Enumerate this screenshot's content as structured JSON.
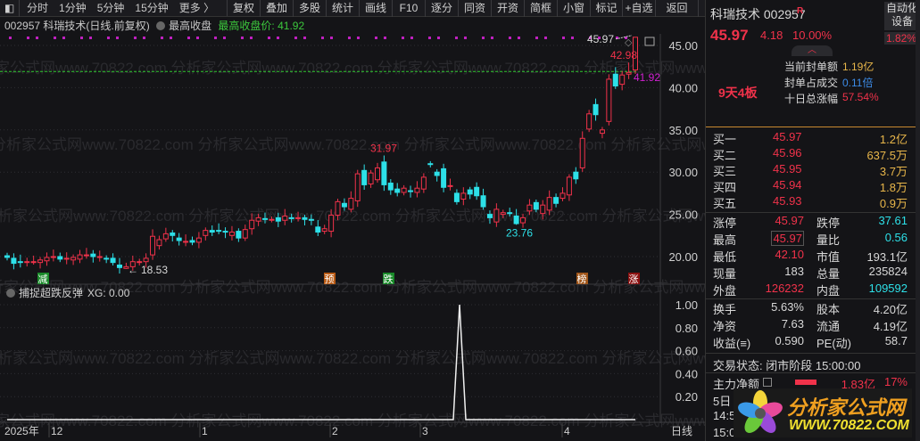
{
  "toolbar": {
    "periods": [
      "分时",
      "1分钟",
      "5分钟",
      "15分钟",
      "更多 〉"
    ],
    "buttons": [
      "复权",
      "叠加",
      "多股",
      "统计",
      "画线",
      "F10",
      "逐分",
      "同资",
      "开资",
      "简框",
      "小窗",
      "标记",
      "+自选",
      "返回"
    ]
  },
  "info": {
    "code_name": "002957 科瑞技术(日线.前复权)",
    "indicator": "最高收盘",
    "value_label": "最高收盘价: 41.92"
  },
  "watermark": "分析家公式网www.70822.com",
  "price_axis": [
    "45.00",
    "40.00",
    "35.00",
    "30.00",
    "25.00",
    "20.00"
  ],
  "annotations": {
    "top": "45.97",
    "prev_high": "42.98",
    "ref": "41.92",
    "peak": "31.97",
    "trough": "23.76",
    "low": "18.53"
  },
  "signals": [
    {
      "label": "减",
      "color": "#1a8a2a"
    },
    {
      "label": "预",
      "color": "#b85a14"
    },
    {
      "label": "跌",
      "color": "#1a8a2a"
    },
    {
      "label": "榜",
      "color": "#a0561a"
    },
    {
      "label": "涨",
      "color": "#8a1010"
    }
  ],
  "indicator_pane": {
    "title": "捕捉超跌反弹",
    "value": "XG: 0.00",
    "axis": [
      "1.00",
      "0.80",
      "0.60",
      "0.40",
      "0.20"
    ]
  },
  "x_axis": {
    "year": "2025年",
    "months": [
      "12",
      "1",
      "2",
      "3",
      "4"
    ],
    "period": "日线"
  },
  "candles": [
    [
      20.1,
      19.9
    ],
    [
      19.8,
      19.2
    ],
    [
      19.4,
      19.3
    ],
    [
      19.3,
      19.4
    ],
    [
      19.4,
      19.4
    ],
    [
      19.3,
      19.6
    ],
    [
      19.5,
      19.9
    ],
    [
      19.9,
      20.0
    ],
    [
      20.0,
      19.7
    ],
    [
      19.8,
      19.8
    ],
    [
      19.6,
      19.9
    ],
    [
      19.7,
      20.2
    ],
    [
      20.1,
      20.2
    ],
    [
      20.3,
      20.0
    ],
    [
      20.0,
      20.0
    ],
    [
      19.8,
      19.7
    ],
    [
      19.8,
      19.3
    ],
    [
      19.0,
      18.7
    ],
    [
      18.6,
      18.8
    ],
    [
      18.8,
      19.4
    ],
    [
      19.3,
      19.4
    ],
    [
      19.4,
      19.8
    ],
    [
      20.2,
      22.4
    ],
    [
      21.3,
      22.0
    ],
    [
      22.1,
      22.7
    ],
    [
      22.8,
      22.5
    ],
    [
      22.2,
      21.9
    ],
    [
      21.7,
      21.8
    ],
    [
      21.9,
      21.7
    ],
    [
      21.7,
      22.2
    ],
    [
      22.5,
      23.1
    ],
    [
      23.1,
      22.9
    ],
    [
      23.1,
      23.0
    ],
    [
      23.0,
      22.9
    ],
    [
      22.5,
      22.9
    ],
    [
      23.0,
      22.2
    ],
    [
      22.2,
      23.2
    ],
    [
      23.3,
      24.3
    ],
    [
      24.2,
      24.6
    ],
    [
      24.5,
      24.4
    ],
    [
      24.4,
      24.4
    ],
    [
      24.6,
      24.2
    ],
    [
      24.3,
      24.8
    ],
    [
      24.6,
      24.5
    ],
    [
      24.5,
      24.6
    ],
    [
      24.6,
      24.4
    ],
    [
      24.4,
      24.3
    ],
    [
      23.5,
      22.9
    ],
    [
      23.0,
      23.3
    ],
    [
      23.0,
      24.9
    ],
    [
      24.9,
      26.5
    ],
    [
      26.3,
      25.9
    ],
    [
      25.6,
      26.9
    ],
    [
      26.6,
      29.8
    ],
    [
      30.2,
      28.5
    ],
    [
      28.6,
      29.9
    ],
    [
      29.1,
      30.5
    ],
    [
      31.2,
      28.5
    ],
    [
      28.7,
      27.9
    ],
    [
      28.0,
      27.6
    ],
    [
      27.6,
      28.1
    ],
    [
      27.8,
      27.7
    ],
    [
      27.6,
      28.1
    ],
    [
      28.0,
      29.4
    ],
    [
      31.0,
      30.9
    ],
    [
      30.0,
      29.6
    ],
    [
      30.4,
      28.2
    ],
    [
      28.3,
      28.4
    ],
    [
      27.5,
      26.5
    ],
    [
      26.8,
      27.5
    ],
    [
      27.9,
      27.4
    ],
    [
      28.2,
      27.2
    ],
    [
      27.2,
      25.9
    ],
    [
      25.0,
      24.6
    ],
    [
      24.1,
      25.6
    ],
    [
      25.0,
      25.2
    ],
    [
      25.2,
      25.1
    ],
    [
      24.8,
      23.9
    ],
    [
      24.0,
      24.6
    ],
    [
      25.4,
      26.1
    ],
    [
      26.4,
      25.6
    ],
    [
      25.1,
      26.1
    ],
    [
      25.5,
      27.0
    ],
    [
      27.0,
      26.3
    ],
    [
      26.9,
      27.5
    ],
    [
      27.3,
      29.4
    ],
    [
      30.0,
      29.2
    ],
    [
      30.5,
      34.0
    ],
    [
      35.1,
      36.9
    ],
    [
      38.0,
      36.8
    ],
    [
      34.6,
      35.0
    ],
    [
      36.0,
      41.0
    ],
    [
      41.6,
      40.2
    ],
    [
      40.4,
      41.5
    ],
    [
      41.6,
      41.8
    ],
    [
      42.1,
      45.97
    ]
  ],
  "panel": {
    "name": "科瑞技术 002957",
    "r_badge": "R",
    "sector": "自动化设备",
    "price": "45.97",
    "change": "4.18",
    "pct": "10.00%",
    "sector_pct": "1.82%",
    "streak": "9天4板",
    "seal": [
      {
        "label": "当前封单额",
        "value": "1.19亿"
      },
      {
        "label": "封单占成交",
        "value": "0.11倍"
      },
      {
        "label": "十日总涨幅",
        "value": "57.54%"
      }
    ],
    "bids": [
      {
        "label": "买一",
        "price": "45.97",
        "vol": "1.2亿"
      },
      {
        "label": "买二",
        "price": "45.96",
        "vol": "637.5万"
      },
      {
        "label": "买三",
        "price": "45.95",
        "vol": "3.7万"
      },
      {
        "label": "买四",
        "price": "45.94",
        "vol": "1.8万"
      },
      {
        "label": "买五",
        "price": "45.93",
        "vol": "0.9万"
      }
    ],
    "stats1": [
      [
        "涨停",
        "45.97",
        "跌停",
        "37.61"
      ],
      [
        "最高",
        "45.97",
        "量比",
        "0.56"
      ],
      [
        "最低",
        "42.10",
        "市值",
        "193.1亿"
      ],
      [
        "现量",
        "183",
        "总量",
        "235824"
      ],
      [
        "外盘",
        "126232",
        "内盘",
        "109592"
      ]
    ],
    "stats2": [
      [
        "换手",
        "5.63%",
        "股本",
        "4.20亿"
      ],
      [
        "净资",
        "7.63",
        "流通",
        "4.19亿"
      ],
      [
        "收益(≡)",
        "0.590",
        "PE(动)",
        "58.7"
      ]
    ],
    "status": "交易状态: 闭市阶段 15:00:00",
    "main_flow": {
      "label": "主力净额",
      "value": "1.83亿",
      "pct": "17%"
    },
    "rows_below": [
      "5日",
      "14:5",
      "15:0"
    ],
    "logo": {
      "title": "分析家公式网",
      "url": "WWW.70822.COM"
    }
  }
}
